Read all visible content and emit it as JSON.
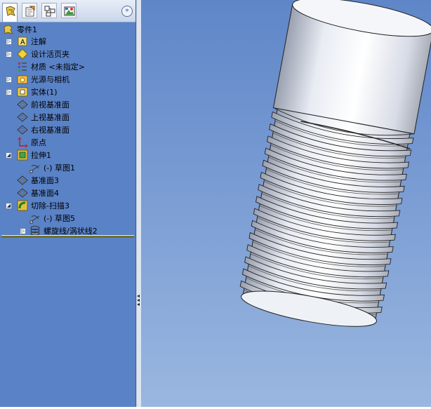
{
  "tabs": [
    {
      "icon": "feature-manager-icon"
    },
    {
      "icon": "property-manager-icon"
    },
    {
      "icon": "configuration-manager-icon"
    },
    {
      "icon": "appearance-manager-icon"
    }
  ],
  "expand_glyph": "»",
  "tree": {
    "root": "零件1",
    "items": [
      {
        "label": "注解",
        "icon": "annotations-icon"
      },
      {
        "label": "设计活页夹",
        "icon": "design-binder-icon"
      },
      {
        "label": "材质 <未指定>",
        "icon": "material-icon"
      },
      {
        "label": "光源与相机",
        "icon": "lights-cameras-icon"
      },
      {
        "label": "实体(1)",
        "icon": "solid-bodies-icon"
      },
      {
        "label": "前视基准面",
        "icon": "plane-icon"
      },
      {
        "label": "上视基准面",
        "icon": "plane-icon"
      },
      {
        "label": "右视基准面",
        "icon": "plane-icon"
      },
      {
        "label": "原点",
        "icon": "origin-icon"
      },
      {
        "label": "拉伸1",
        "icon": "extrude-feature-icon"
      },
      {
        "label": "(-) 草图1",
        "icon": "sketch-icon"
      },
      {
        "label": "基准面3",
        "icon": "plane-icon"
      },
      {
        "label": "基准面4",
        "icon": "plane-icon"
      },
      {
        "label": "切除-扫描3",
        "icon": "cut-sweep-icon"
      },
      {
        "label": "(-) 草图5",
        "icon": "sketch-icon"
      },
      {
        "label": "螺旋线/涡状线2",
        "icon": "helix-icon"
      }
    ]
  },
  "colors": {
    "panel_bg": "#5a82c6",
    "viewport_top": "#5f86c8",
    "viewport_bottom": "#9ab7e0",
    "rollback_bar": "#d4d42a"
  }
}
